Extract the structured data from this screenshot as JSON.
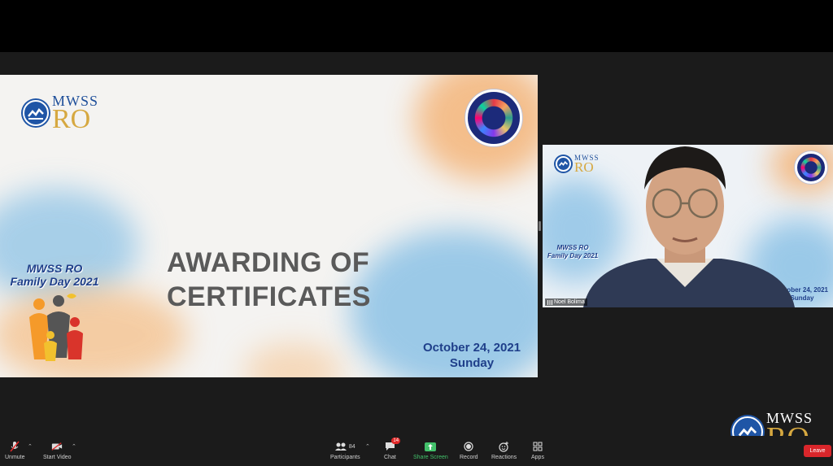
{
  "slide": {
    "title_line1": "AWARDING OF",
    "title_line2": "CERTIFICATES",
    "logo_text1": "MWSS",
    "logo_text2": "RO",
    "event_line1": "MWSS RO",
    "event_line2": "Family Day 2021",
    "date": "October 24, 2021",
    "day": "Sunday",
    "seal_icon": "gender-and-development-seal-icon"
  },
  "participant": {
    "name": "Noel Bolima"
  },
  "corner_logo": {
    "text1": "MWSS",
    "text2": "RO"
  },
  "toolbar": {
    "unmute": "Unmute",
    "start_video": "Start Video",
    "participants": "Participants",
    "participants_count": "84",
    "chat": "Chat",
    "chat_badge": "14",
    "share_screen": "Share Screen",
    "record": "Record",
    "reactions": "Reactions",
    "apps": "Apps",
    "leave": "Leave"
  },
  "colors": {
    "accent_green": "#43c16b",
    "leave_red": "#d9262b",
    "slide_blue": "#1f3f8a"
  }
}
